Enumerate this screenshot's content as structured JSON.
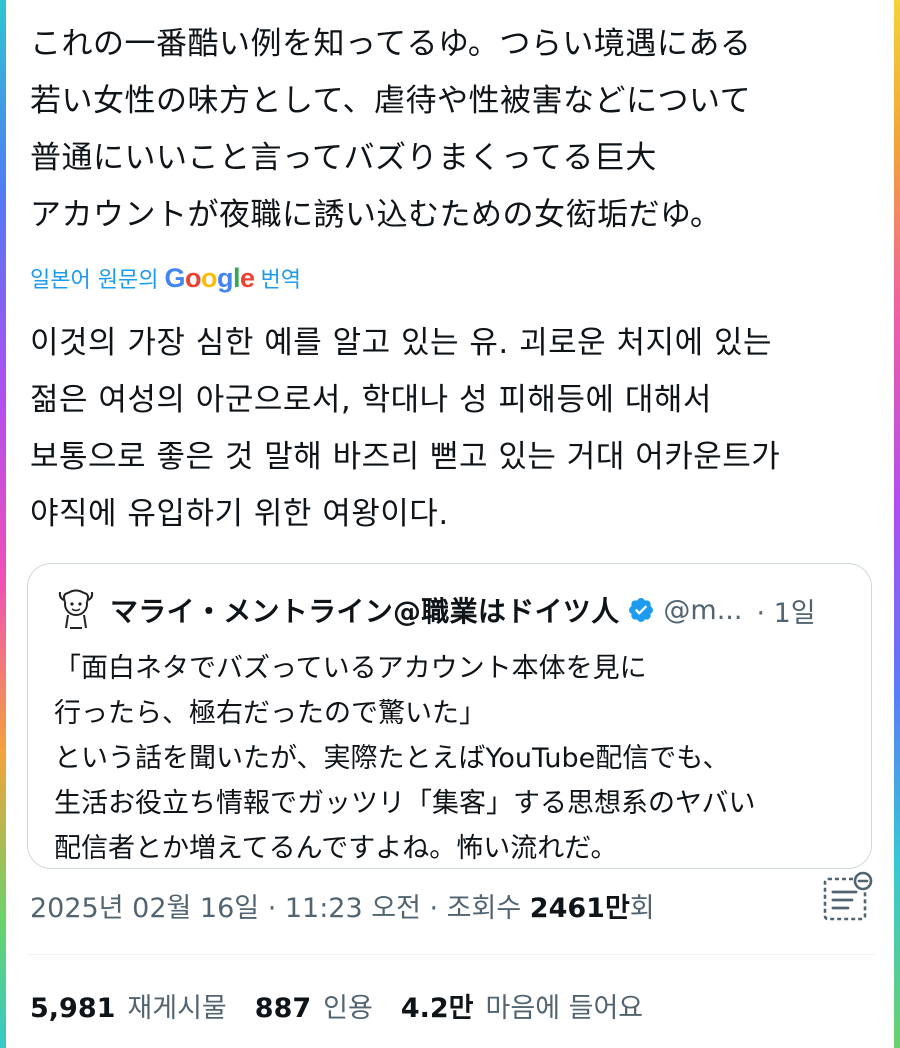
{
  "tweet": {
    "original_text": "これの一番酷い例を知ってるゆ。つらい境遇にある\n若い女性の味方として、虐待や性被害などについて\n普通にいいこと言ってバズりまくってる巨大\nアカウントが夜職に誘い込むための女衒垢だゆ。",
    "translation_prefix": "일본어 원문의",
    "translation_brand": "Google",
    "translation_suffix": "번역",
    "translated_text": "이것의 가장 심한 예를 알고 있는 유. 괴로운 처지에 있는\n젊은 여성의 아군으로서, 학대나 성 피해등에 대해서\n보통으로 좋은 것 말해 바즈리 뻗고 있는 거대 어카운트가\n야직에 유입하기 위한 여왕이다."
  },
  "quote": {
    "author_name": "マライ・メントライン@職業はドイツ人",
    "handle": "@m...",
    "time": "· 1일",
    "text": "「面白ネタでバズっているアカウント本体を見に\n行ったら、極右だったので驚いた」\nという話を聞いたが、実際たとえばYouTube配信でも、\n生活お役立ち情報でガッツリ「集客」する思想系のヤバい\n配信者とか増えてるんですよね。怖い流れだ。"
  },
  "meta": {
    "timestamp": "2025년 02월 16일 · 11:23 오전 · 조회수",
    "views": "2461만",
    "views_suffix": "회"
  },
  "stats": {
    "reposts_value": "5,981",
    "reposts_label": "재게시물",
    "quotes_value": "887",
    "quotes_label": "인용",
    "likes_value": "4.2만",
    "likes_label": "마음에 들어요"
  },
  "colors": {
    "link_blue": "#1d9bf0",
    "secondary_text": "#536471",
    "verified_blue": "#1d9bf0"
  },
  "icons": {
    "verified": "verified-badge-icon",
    "analytics": "view-analytics-icon",
    "avatar": "avatar"
  }
}
